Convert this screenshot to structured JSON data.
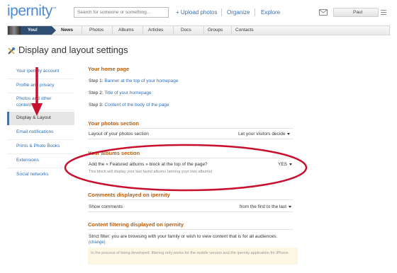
{
  "header": {
    "logo": "ipernity",
    "logo_tm": "™",
    "search_placeholder": "Search for someone or something...",
    "upload_label": "+ Upload photos",
    "organize_label": "Organize",
    "explore_label": "Explore",
    "user_name": "Paul"
  },
  "tabs": {
    "you_label": "You!",
    "items": [
      "News",
      "Photos",
      "Albums",
      "Articles",
      "Docs",
      "Groups",
      "Contacts"
    ]
  },
  "page_title": "Display and layout settings",
  "sidebar": {
    "items": [
      "Your ipernity account",
      "Profile and privacy",
      "Photos and other content",
      "Display & Layout",
      "Email notifications",
      "Prints & Photo Books",
      "Extensions",
      "Social networks"
    ],
    "active_index": 3
  },
  "home_section": {
    "title": "Your home page",
    "steps": [
      {
        "prefix": "Step 1:",
        "link": "Banner at the top of your homepage"
      },
      {
        "prefix": "Step 2:",
        "link": "Title of your homepage"
      },
      {
        "prefix": "Step 3:",
        "link": "Content of the body of the page"
      }
    ]
  },
  "photos_section": {
    "title": "Your photos section",
    "row_label": "Layout of your photos section",
    "row_value": "Let your visitors decide"
  },
  "albums_section": {
    "title": "Your albums section",
    "row_label": "Add the « Featured albums » block at the top of the page?",
    "row_value": "YES",
    "row_note": "This block will display your last faved albums (among your own albums)."
  },
  "comments_section": {
    "title": "Comments displayed on ipernity",
    "row_label": "Show comments",
    "row_value": "from the first to the last"
  },
  "filtering_section": {
    "title": "Content filtering displayed on ipernity",
    "text": "Strict filter: you are browsing with your family or wish to view content that is for all audiences.",
    "change_label": "(change)",
    "notice": "In the process of being developed: filtering only works for the mobile version and the ipernity application for iPhone."
  },
  "colors": {
    "accent_orange": "#b35d10",
    "link_blue": "#2f6fb3",
    "annotation_red": "#c8102e",
    "you_tab": "#2e4d70"
  }
}
